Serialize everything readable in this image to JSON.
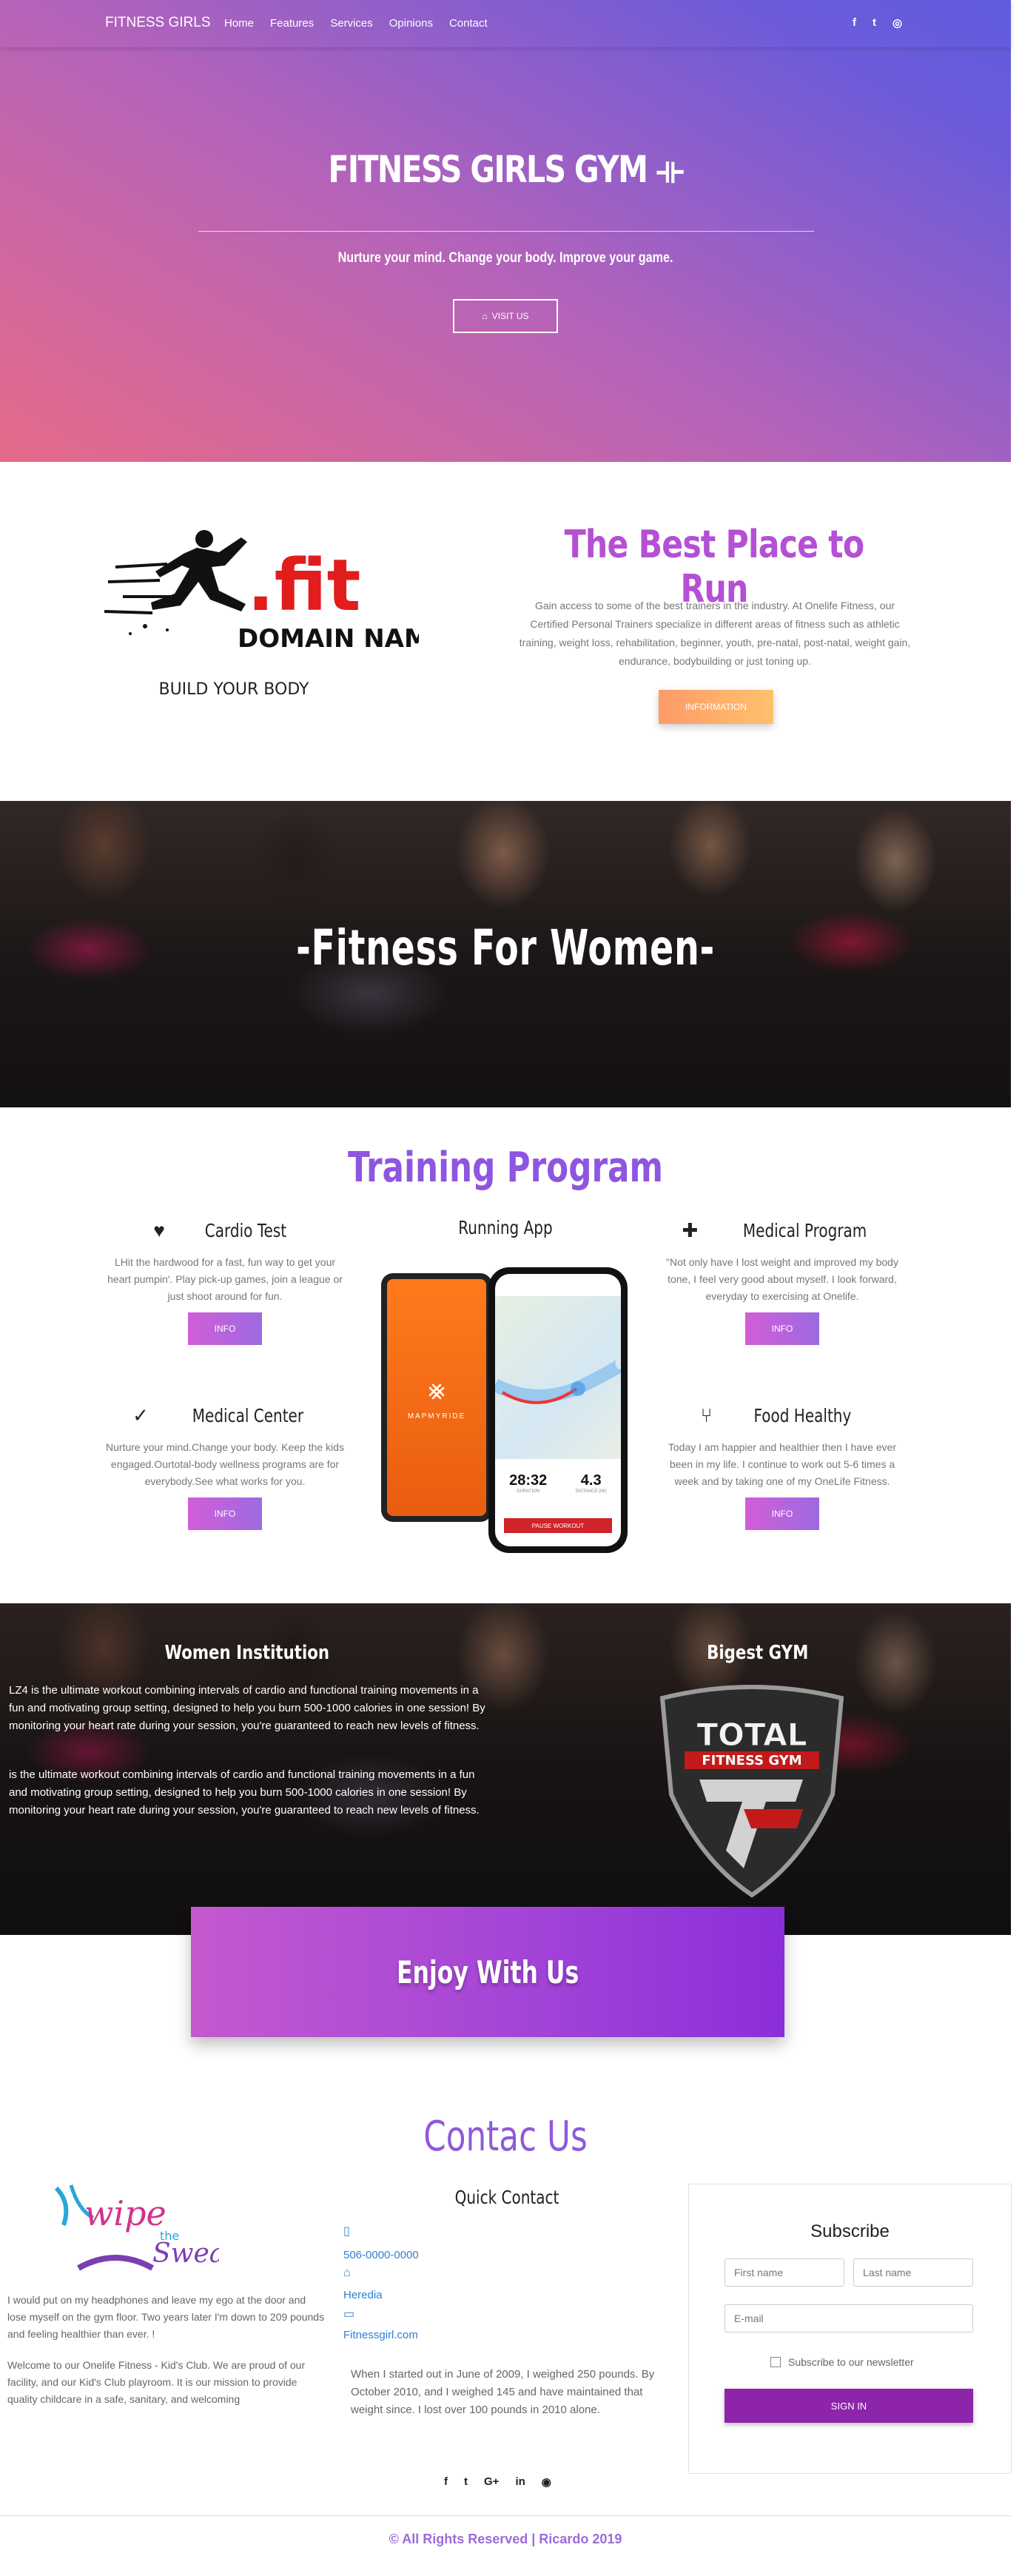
{
  "nav": {
    "brand": "FITNESS GIRLS",
    "links": [
      "Home",
      "Features",
      "Services",
      "Opinions",
      "Contact"
    ],
    "social": [
      "f",
      "t",
      "◎"
    ]
  },
  "hero": {
    "title": "FITNESS GIRLS GYM",
    "tagline": "Nurture your mind. Change your body. Improve your game.",
    "button": "VISIT US"
  },
  "best": {
    "logo_text": ".fit",
    "logo_sub": "DOMAIN NAMES",
    "logo_caption": "BUILD YOUR BODY",
    "title": "The Best Place to Run",
    "text": "Gain access to some of the best trainers in the industry. At Onelife Fitness, our Certified Personal Trainers specialize in different areas of fitness such as athletic training, weight loss, rehabilitation, beginner, youth, pre-natal, post-natal, weight gain, endurance, bodybuilding or just toning up.",
    "button": "INFORMATION"
  },
  "women": {
    "title": "-Fitness For Women-"
  },
  "training": {
    "title": "Training Program",
    "running_title": "Running App",
    "cards": [
      {
        "title": "Cardio Test",
        "icon": "heartbeat-icon",
        "text": "LHit the hardwood for a fast, fun way to get your heart pumpin'. Play pick-up games, join a league or just shoot around for fun.",
        "button": "INFO"
      },
      {
        "title": "Medical Program",
        "icon": "medical-kit-icon",
        "text": "\"Not only have I lost weight and improved my body tone, I feel very good about myself. I look forward, everyday to exercising at Onelife.",
        "button": "INFO"
      },
      {
        "title": "Medical Center",
        "icon": "spell-check-icon",
        "text": "Nurture your mind.Change your body. Keep the kids engaged.Ourtotal-body wellness programs are for everybody.See what works for you.",
        "button": "INFO"
      },
      {
        "title": "Food Healthy",
        "icon": "utensils-icon",
        "text": "Today I am happier and healthier then I have ever been in my life. I continue to work out 5-6 times a week and by taking one of my OneLife Fitness.",
        "button": "INFO"
      }
    ],
    "phone": {
      "brand": "MAPMYRIDE",
      "time": "28:32",
      "distance": "4.3",
      "time_label": "DURATION",
      "distance_label": "DISTANCE (MI)",
      "action": "PAUSE WORKOUT"
    }
  },
  "institution": {
    "title": "Women Institution",
    "p1": "LZ4 is the ultimate workout combining intervals of cardio and functional training movements in a fun and motivating group setting, designed to help you burn 500-1000 calories in one session! By monitoring your heart rate during your session, you're guaranteed to reach new levels of fitness.",
    "p2": "is the ultimate workout combining intervals of cardio and functional training movements in a fun and motivating group setting, designed to help you burn 500-1000 calories in one session! By monitoring your heart rate during your session, you're guaranteed to reach new levels of fitness.",
    "gym_title": "Bigest GYM",
    "shield_top": "TOTAL",
    "shield_sub": "FITNESS GYM"
  },
  "enjoy": {
    "text": "Enjoy With Us"
  },
  "contact": {
    "title": "Contac Us",
    "logo_text": "wipe",
    "logo_the": "the",
    "logo_sweat": "Sweat",
    "p1": "I would put on my headphones and leave my ego at the door and lose myself on the gym floor. Two years later I'm down to 209 pounds and feeling healthier than ever. !",
    "p2": "Welcome to our Onelife Fitness - Kid's Club. We are proud of our facility, and our Kid's Club playroom. It is our mission to provide quality childcare in a safe, sanitary, and welcoming",
    "quick_title": "Quick Contact",
    "phone": "506-0000-0000",
    "city": "Heredia",
    "site": "Fitnessgirl.com",
    "note": "When I started out in June of 2009, I weighed 250 pounds. By October 2010, and I weighed 145 and have maintained that weight since. I lost over 100 pounds in 2010 alone."
  },
  "subscribe": {
    "title": "Subscribe",
    "first_placeholder": "First name",
    "last_placeholder": "Last name",
    "email_placeholder": "E-mail",
    "checkbox": "Subscribe to our newsletter",
    "button": "SIGN IN"
  },
  "footer": {
    "social": [
      "f",
      "t",
      "G+",
      "in",
      "◉"
    ],
    "copyright": "© All Rights Reserved | Ricardo 2019"
  }
}
